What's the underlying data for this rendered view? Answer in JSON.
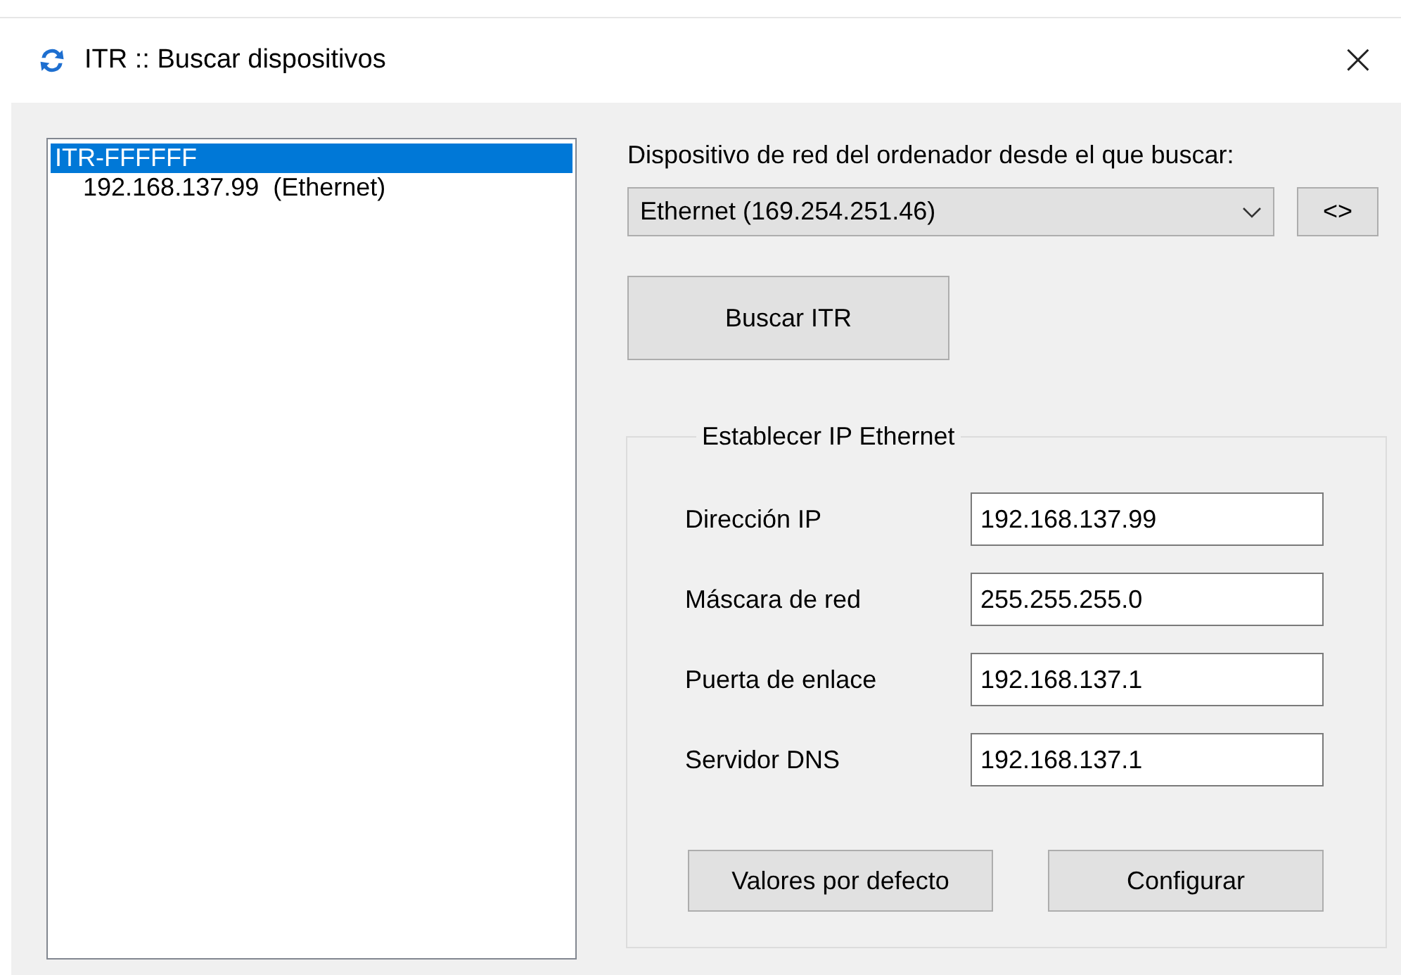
{
  "window": {
    "title": "ITR :: Buscar dispositivos",
    "close": "×"
  },
  "device_list": {
    "items": [
      {
        "label": "ITR-FFFFFF",
        "selected": true,
        "children": [
          {
            "label": "192.168.137.99  (Ethernet)",
            "selected": false
          }
        ]
      }
    ]
  },
  "network_device": {
    "label": "Dispositivo de red del ordenador desde el que buscar:",
    "value": "Ethernet (169.254.251.46)",
    "toggle": "<>"
  },
  "search_button": "Buscar ITR",
  "ip_group": {
    "title": "Establecer IP Ethernet",
    "fields": [
      {
        "label": "Dirección IP",
        "value": "192.168.137.99"
      },
      {
        "label": "Máscara de red",
        "value": "255.255.255.0"
      },
      {
        "label": "Puerta de enlace",
        "value": "192.168.137.1"
      },
      {
        "label": "Servidor DNS",
        "value": "192.168.137.1"
      }
    ],
    "buttons": [
      "Valores por defecto",
      "Configurar"
    ]
  }
}
